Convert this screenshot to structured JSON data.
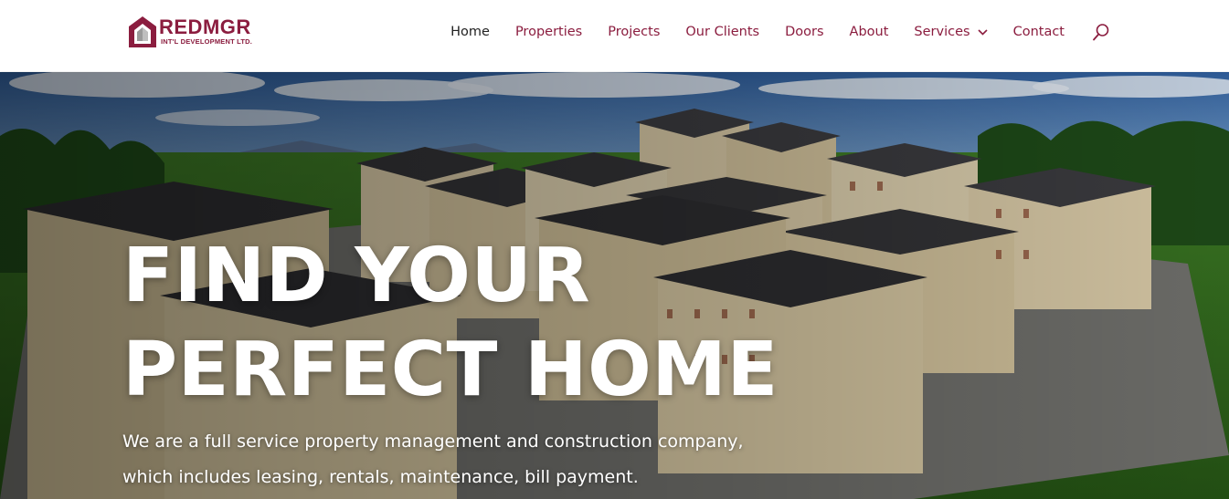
{
  "brand": {
    "name": "REDMGR",
    "tagline": "INT'L DEVELOPMENT LTD."
  },
  "nav": {
    "items": [
      {
        "label": "Home",
        "active": true
      },
      {
        "label": "Properties",
        "active": false
      },
      {
        "label": "Projects",
        "active": false
      },
      {
        "label": "Our Clients",
        "active": false
      },
      {
        "label": "Doors",
        "active": false
      },
      {
        "label": "About",
        "active": false
      },
      {
        "label": "Services",
        "active": false,
        "has_dropdown": true
      },
      {
        "label": "Contact",
        "active": false
      }
    ],
    "search_icon": "search-icon"
  },
  "hero": {
    "title_line1": "FIND YOUR",
    "title_line2": "PERFECT HOME",
    "description_line1": "We are a full service property management and construction company,",
    "description_line2": "which includes leasing, rentals, maintenance, bill payment."
  },
  "colors": {
    "brand": "#8b1d3f",
    "nav_active": "#222222",
    "nav_link": "#8b1d3f",
    "hero_text": "#ffffff"
  }
}
